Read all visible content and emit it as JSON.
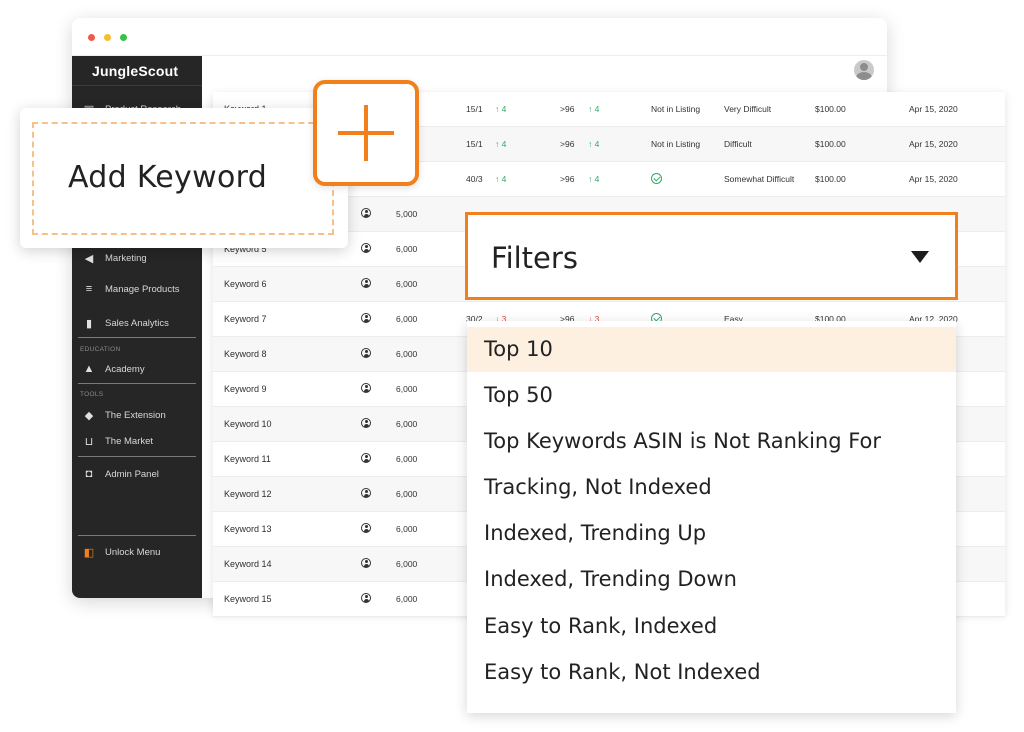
{
  "brand": "JungleScout",
  "sidebar": {
    "items": [
      {
        "label": "Product Research",
        "icon": "box-icon"
      },
      {
        "label": "Marketing",
        "icon": "megaphone-icon"
      },
      {
        "label": "Manage Products",
        "icon": "stack-icon"
      },
      {
        "label": "Sales Analytics",
        "icon": "bar-chart-icon"
      },
      {
        "label": "Academy",
        "icon": "graduation-cap-icon"
      },
      {
        "label": "The Extension",
        "icon": "extension-icon"
      },
      {
        "label": "The Market",
        "icon": "cart-icon"
      },
      {
        "label": "Admin Panel",
        "icon": "shield-icon"
      },
      {
        "label": "Unlock Menu",
        "icon": "unlock-icon"
      }
    ],
    "sections": {
      "education": "EDUCATION",
      "tools": "TOOLS"
    }
  },
  "add_keyword": {
    "label": "Add Keyword"
  },
  "filters": {
    "label": "Filters",
    "options": [
      "Top 10",
      "Top 50",
      "Top Keywords ASIN is Not Ranking For",
      "Tracking, Not Indexed",
      "Indexed, Trending Up",
      "Indexed, Trending Down",
      "Easy to Rank, Indexed",
      "Easy to Rank, Not Indexed"
    ],
    "active_option": "Top 10"
  },
  "table": {
    "rows": [
      {
        "keyword": "Keyword 1",
        "volume": "",
        "rank1": "15/1",
        "trend1": "↑ 4",
        "rank2": ">96",
        "trend2": "↑ 4",
        "indexed": "Not in Listing",
        "difficulty": "Very Difficult",
        "price": "$100.00",
        "date": "Apr 15, 2020"
      },
      {
        "keyword": "",
        "volume": "",
        "rank1": "15/1",
        "trend1": "↑ 4",
        "rank2": ">96",
        "trend2": "↑ 4",
        "indexed": "Not in Listing",
        "difficulty": "Difficult",
        "price": "$100.00",
        "date": "Apr 15, 2020"
      },
      {
        "keyword": "",
        "volume": "",
        "rank1": "40/3",
        "trend1": "↑ 4",
        "rank2": ">96",
        "trend2": "↑ 4",
        "indexed": "check",
        "difficulty": "Somewhat Difficult",
        "price": "$100.00",
        "date": "Apr 15, 2020"
      },
      {
        "keyword": "",
        "volume": "5,000",
        "rank1": "",
        "trend1": "",
        "rank2": "",
        "trend2": "",
        "indexed": "",
        "difficulty": "",
        "price": "",
        "date": ""
      },
      {
        "keyword": "Keyword 5",
        "volume": "6,000",
        "rank1": "",
        "trend1": "",
        "rank2": "",
        "trend2": "",
        "indexed": "",
        "difficulty": "",
        "price": "",
        "date": ""
      },
      {
        "keyword": "Keyword 6",
        "volume": "6,000",
        "rank1": "",
        "trend1": "",
        "rank2": "",
        "trend2": "",
        "indexed": "",
        "difficulty": "",
        "price": "",
        "date": ""
      },
      {
        "keyword": "Keyword 7",
        "volume": "6,000",
        "rank1": "30/2",
        "trend1": "↓ 3",
        "rank2": ">96",
        "trend2": "↓ 3",
        "indexed": "check",
        "difficulty": "Easy",
        "price": "$100.00",
        "date": "Apr 12, 2020"
      },
      {
        "keyword": "Keyword 8",
        "volume": "6,000",
        "rank1": "",
        "trend1": "",
        "rank2": "",
        "trend2": "",
        "indexed": "",
        "difficulty": "",
        "price": "",
        "date": ""
      },
      {
        "keyword": "Keyword 9",
        "volume": "6,000",
        "rank1": "",
        "trend1": "",
        "rank2": "",
        "trend2": "",
        "indexed": "",
        "difficulty": "",
        "price": "",
        "date": ""
      },
      {
        "keyword": "Keyword 10",
        "volume": "6,000",
        "rank1": "",
        "trend1": "",
        "rank2": "",
        "trend2": "",
        "indexed": "",
        "difficulty": "",
        "price": "",
        "date": ""
      },
      {
        "keyword": "Keyword 11",
        "volume": "6,000",
        "rank1": "",
        "trend1": "",
        "rank2": "",
        "trend2": "",
        "indexed": "",
        "difficulty": "",
        "price": "",
        "date": ""
      },
      {
        "keyword": "Keyword 12",
        "volume": "6,000",
        "rank1": "",
        "trend1": "",
        "rank2": "",
        "trend2": "",
        "indexed": "",
        "difficulty": "",
        "price": "",
        "date": ""
      },
      {
        "keyword": "Keyword 13",
        "volume": "6,000",
        "rank1": "",
        "trend1": "",
        "rank2": "",
        "trend2": "",
        "indexed": "",
        "difficulty": "",
        "price": "",
        "date": ""
      },
      {
        "keyword": "Keyword 14",
        "volume": "6,000",
        "rank1": "",
        "trend1": "",
        "rank2": "",
        "trend2": "",
        "indexed": "",
        "difficulty": "",
        "price": "",
        "date": ""
      },
      {
        "keyword": "Keyword 15",
        "volume": "6,000",
        "rank1": "",
        "trend1": "",
        "rank2": "",
        "trend2": "",
        "indexed": "",
        "difficulty": "",
        "price": "",
        "date": ""
      }
    ]
  },
  "colors": {
    "accent": "#f07f1c",
    "sidebar_bg": "#262626",
    "trend_up": "#2faa6a",
    "trend_down": "#e04a3a",
    "active_option_bg": "#fdf0e1"
  }
}
